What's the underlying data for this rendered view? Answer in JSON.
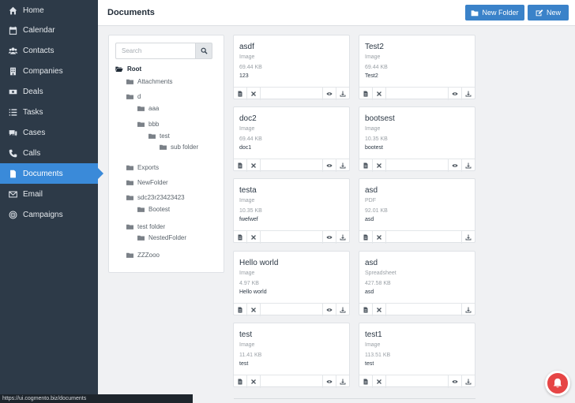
{
  "sidebar": {
    "items": [
      {
        "label": "Home",
        "icon": "home-icon"
      },
      {
        "label": "Calendar",
        "icon": "calendar-icon"
      },
      {
        "label": "Contacts",
        "icon": "users-icon"
      },
      {
        "label": "Companies",
        "icon": "building-icon"
      },
      {
        "label": "Deals",
        "icon": "money-icon"
      },
      {
        "label": "Tasks",
        "icon": "list-icon"
      },
      {
        "label": "Cases",
        "icon": "comments-icon"
      },
      {
        "label": "Calls",
        "icon": "phone-icon"
      },
      {
        "label": "Documents",
        "icon": "document-icon",
        "active": true
      },
      {
        "label": "Email",
        "icon": "envelope-icon"
      },
      {
        "label": "Campaigns",
        "icon": "target-icon"
      }
    ]
  },
  "header": {
    "title": "Documents",
    "new_folder_label": "New Folder",
    "new_label": "New"
  },
  "tree": {
    "search_placeholder": "Search",
    "root": "Root",
    "nodes": {
      "attachments": "Attachments",
      "d": "d",
      "aaa": "aaa",
      "bbb": "bbb",
      "test": "test",
      "sub_folder": "sub folder",
      "exports": "Exports",
      "newfolder": "NewFolder",
      "sdc": "sdc23r23423423",
      "bootest": "Bootest",
      "test_folder": "test folder",
      "nested": "NestedFolder",
      "zzzooo": "ZZZooo"
    }
  },
  "documents": [
    {
      "name": "asdf",
      "type": "Image",
      "size": "69.44 KB",
      "desc": "123",
      "viewable": true
    },
    {
      "name": "Test2",
      "type": "Image",
      "size": "69.44 KB",
      "desc": "Test2",
      "viewable": true
    },
    {
      "name": "doc2",
      "type": "Image",
      "size": "69.44 KB",
      "desc": "doc1",
      "viewable": true
    },
    {
      "name": "bootsest",
      "type": "Image",
      "size": "10.35 KB",
      "desc": "bootest",
      "viewable": true
    },
    {
      "name": "testa",
      "type": "Image",
      "size": "10.35 KB",
      "desc": "fwefwef",
      "viewable": true
    },
    {
      "name": "asd",
      "type": "PDF",
      "size": "92.01 KB",
      "desc": "asd",
      "viewable": false
    },
    {
      "name": "Hello world",
      "type": "Image",
      "size": "4.97 KB",
      "desc": "Hello world",
      "viewable": true
    },
    {
      "name": "asd",
      "type": "Spreadsheet",
      "size": "427.58 KB",
      "desc": "asd",
      "viewable": false
    },
    {
      "name": "test",
      "type": "Image",
      "size": "11.41 KB",
      "desc": "test",
      "viewable": true
    },
    {
      "name": "test1",
      "type": "Image",
      "size": "113.51 KB",
      "desc": "test",
      "viewable": true
    }
  ],
  "status_bar": {
    "url": "https://ui.cogmento.biz/documents"
  },
  "colors": {
    "sidebar_bg": "#2d3a48",
    "accent": "#3a8ad9",
    "button": "#3a82c9",
    "notification": "#e64545"
  }
}
